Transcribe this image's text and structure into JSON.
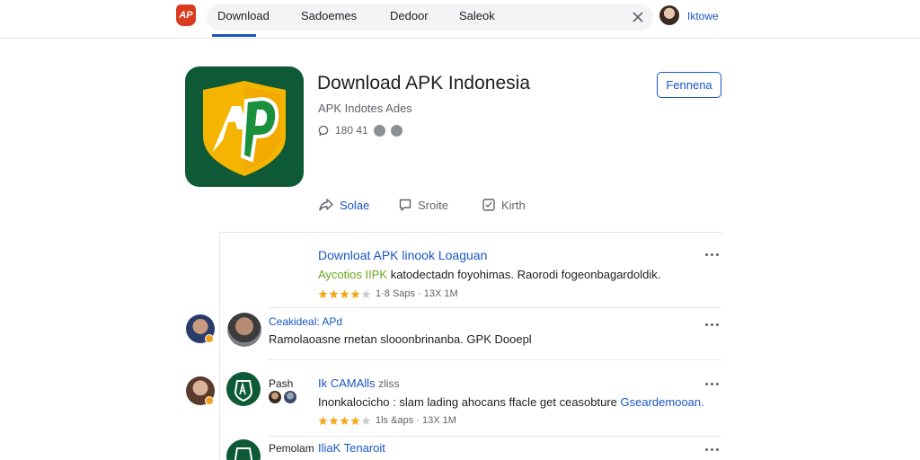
{
  "header": {
    "nav_tabs": [
      {
        "label": "Download"
      },
      {
        "label": "Sadoemes"
      },
      {
        "label": "Dedoor"
      },
      {
        "label": "Saleok"
      }
    ],
    "user_name": "Iktowe"
  },
  "app": {
    "logo_text": "AP",
    "title": "Download APK Indonesia",
    "subtitle": "APK Indotes Ades",
    "stats_text": "180 41",
    "follow_label": "Fennena",
    "actions": [
      {
        "label": "Solae",
        "icon": "share-icon"
      },
      {
        "label": "Sroite",
        "icon": "comment-icon"
      },
      {
        "label": "Kirth",
        "icon": "save-icon"
      }
    ]
  },
  "feed": {
    "posts": [
      {
        "title": "Downloat APK linook Loaguan",
        "text_highlight": "Aycotios IIPK",
        "text_rest": " katodectadn foyohimas. Raorodi fogeonbagardoldik.",
        "rating": 4,
        "meta": "1·8 Saps · 13X 1M"
      },
      {
        "name": "Ceakideal: APd",
        "text": "Ramolaoasne rnetan slooonbrinanba. GPK Dooepl"
      },
      {
        "commenter": "Pash",
        "title": "Ik CAMAlls",
        "title_muted": "zliss",
        "text_main": "Inonkalocicho : slam lading ahocans ffacle get ceasobture ",
        "text_link": "Gseardemooan.",
        "rating": 4,
        "meta": "1ls &aps · 13X 1M"
      },
      {
        "commenter": "Pemolam",
        "title": "IliaK Tenaroit"
      }
    ]
  },
  "colors": {
    "accent": "#1a56c4",
    "brand_green": "#0e5a36",
    "brand_yellow": "#f4b400",
    "star": "#f2a91a"
  }
}
